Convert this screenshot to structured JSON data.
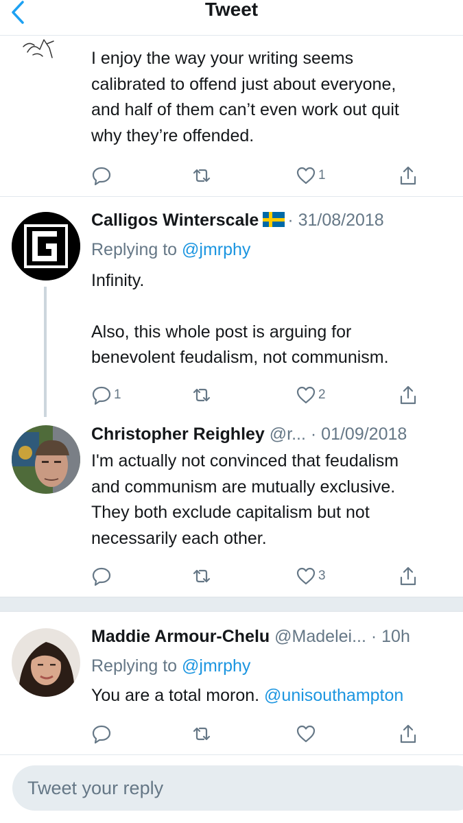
{
  "header": {
    "title": "Tweet",
    "back_icon": "chevron-left-icon",
    "accent": "#1da1f2"
  },
  "tweets": [
    {
      "text_lines": [
        "I enjoy the way your writing seems",
        "calibrated to offend just about everyone,",
        "and half of them can’t even work out quit",
        "why they’re offended."
      ],
      "actions": {
        "reply": "",
        "retweet": "",
        "like": "1"
      }
    },
    {
      "name": "Calligos Winterscale",
      "flag": "sweden-flag-icon",
      "meta": "· 31/08/2018",
      "replying_prefix": "Replying to",
      "replying_handle": "@jmrphy",
      "text_lines": [
        "Infinity.",
        "",
        "Also, this whole post is arguing for",
        "benevolent feudalism, not communism."
      ],
      "actions": {
        "reply": "1",
        "retweet": "",
        "like": "2"
      }
    },
    {
      "name": "Christopher Reighley",
      "meta": "@r...  · 01/09/2018",
      "text_lines": [
        "I'm actually not convinced that feudalism",
        "and communism are mutually exclusive.",
        "They both exclude capitalism but not",
        "necessarily each other."
      ],
      "actions": {
        "reply": "",
        "retweet": "",
        "like": "3"
      }
    },
    {
      "name": "Maddie Armour-Chelu",
      "meta": "@Madelei... · 10h",
      "replying_prefix": "Replying to",
      "replying_handle": "@jmrphy",
      "text": "You are a total moron.",
      "mention": "@unisouthampton",
      "actions": {
        "reply": "",
        "retweet": "",
        "like": ""
      }
    }
  ],
  "composer": {
    "placeholder": "Tweet your reply"
  },
  "colors": {
    "text": "#14171a",
    "secondary": "#657786",
    "link": "#1b95e0",
    "divider": "#e1e8ed",
    "composer_bg": "#e6ecf0"
  }
}
